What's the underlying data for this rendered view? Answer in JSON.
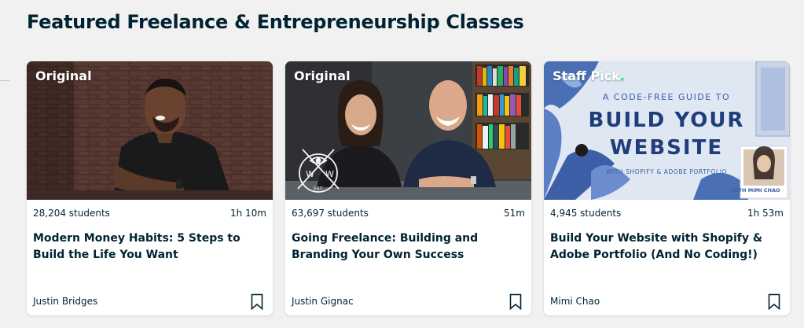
{
  "section": {
    "title": "Featured Freelance & Entrepreneurship Classes"
  },
  "colors": {
    "accent": "#00ff84",
    "text": "#002333",
    "background": "#f1f1f1"
  },
  "cards": [
    {
      "badge": "Original",
      "students": "28,204 students",
      "duration": "1h 10m",
      "title": "Modern Money Habits: 5 Steps to Build the Life You Want",
      "teacher": "Justin Bridges",
      "bookmark_icon": "bookmark-icon"
    },
    {
      "badge": "Original",
      "students": "63,697 students",
      "duration": "51m",
      "title": "Going Freelance: Building and Branding Your Own Success",
      "teacher": "Justin Gignac",
      "bookmark_icon": "bookmark-icon",
      "logo_text": {
        "left": "W",
        "right": "W",
        "bottom": "EST."
      }
    },
    {
      "badge": "Staff Pick",
      "students": "4,945 students",
      "duration": "1h 53m",
      "title": "Build Your Website with Shopify & Adobe Portfolio (And No Coding!)",
      "teacher": "Mimi Chao",
      "bookmark_icon": "bookmark-icon",
      "thumb_text": {
        "line1": "A CODE-FREE GUIDE TO",
        "line2": "BUILD YOUR",
        "line3": "WEBSITE",
        "line4": "WITH SHOPIFY & ADOBE PORTFOLIO",
        "with_label": "WITH MIMI CHAO"
      }
    }
  ]
}
